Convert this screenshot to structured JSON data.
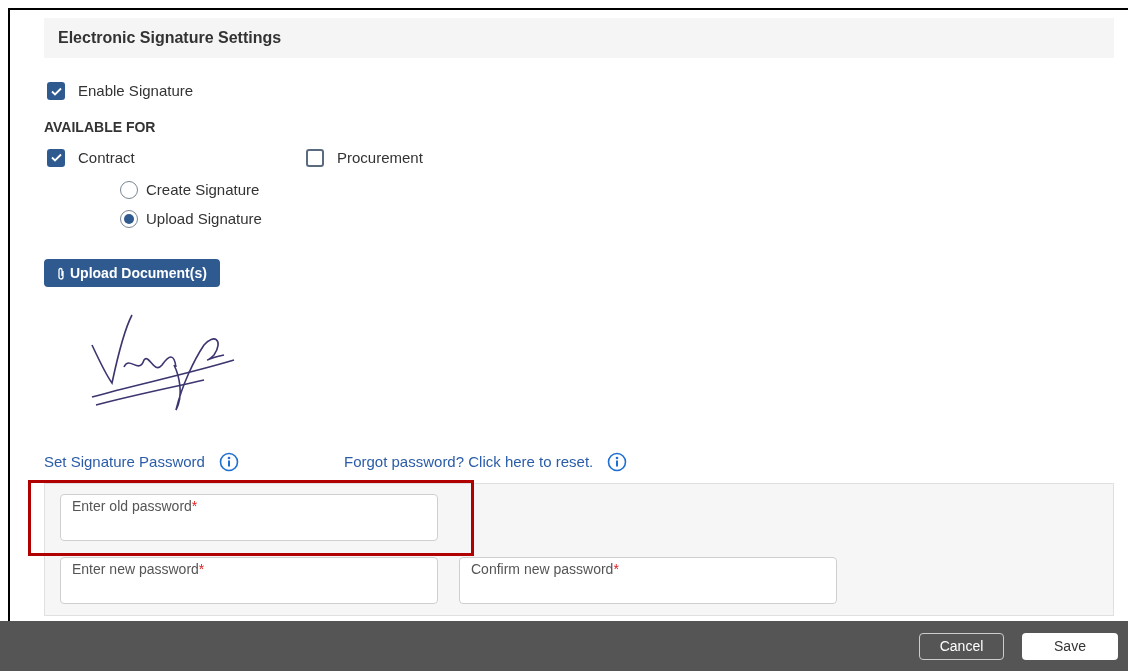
{
  "section_title": "Electronic Signature Settings",
  "enable_signature": {
    "label": "Enable Signature",
    "checked": true
  },
  "available_for": {
    "heading": "AVAILABLE FOR",
    "options": [
      {
        "label": "Contract",
        "checked": true
      },
      {
        "label": "Procurement",
        "checked": false
      }
    ]
  },
  "signature_modes": [
    {
      "label": "Create Signature",
      "selected": false
    },
    {
      "label": "Upload Signature",
      "selected": true
    }
  ],
  "upload_button": "Upload Document(s)",
  "links": [
    {
      "label": "Set Signature Password"
    },
    {
      "label": "Forgot password? Click here to reset."
    }
  ],
  "password_fields": [
    {
      "label": "Enter old password",
      "required_mark": "*",
      "highlighted": true
    },
    {
      "label": "Enter new password",
      "required_mark": "*",
      "highlighted": false
    },
    {
      "label": "Confirm new password",
      "required_mark": "*",
      "highlighted": false
    }
  ],
  "footer_buttons": [
    {
      "label": "Cancel",
      "kind": "secondary"
    },
    {
      "label": "Save",
      "kind": "primary"
    }
  ]
}
